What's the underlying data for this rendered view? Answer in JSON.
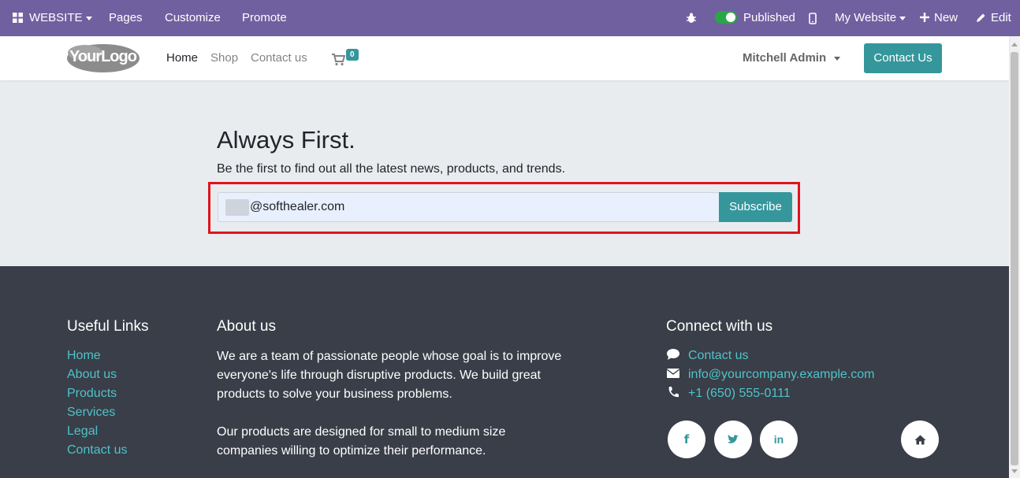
{
  "adminbar": {
    "website_menu": "WEBSITE",
    "pages": "Pages",
    "customize": "Customize",
    "promote": "Promote",
    "published": "Published",
    "site_selector": "My Website",
    "new": "New",
    "edit": "Edit"
  },
  "header": {
    "logo_text": "YourLogo",
    "nav": [
      "Home",
      "Shop",
      "Contact us"
    ],
    "cart_count": "0",
    "user": "Mitchell Admin",
    "contact_button": "Contact Us"
  },
  "newsletter": {
    "title": "Always First.",
    "subtitle": "Be the first to find out all the latest news, products, and trends.",
    "email_value": "@softhealer.com",
    "subscribe_label": "Subscribe"
  },
  "footer": {
    "useful_links_title": "Useful Links",
    "useful_links": [
      "Home",
      "About us",
      "Products",
      "Services",
      "Legal",
      "Contact us"
    ],
    "about_title": "About us",
    "about_p1": [
      "We are a team of passionate people whose goal is to improve",
      "everyone's life through disruptive products. We build great",
      "products to solve your business problems."
    ],
    "about_p2": [
      "Our products are designed for small to medium size",
      "companies willing to optimize their performance."
    ],
    "connect_title": "Connect with us",
    "connect_contact": "Contact us",
    "connect_email": "info@yourcompany.example.com",
    "connect_phone": "+1 (650) 555-0111",
    "social": [
      "facebook-icon",
      "twitter-icon",
      "linkedin-icon",
      "home-icon"
    ]
  },
  "colors": {
    "admin_bar": "#7160a0",
    "primary": "#35979c",
    "link": "#4fc3c9",
    "footer_bg": "#393e48",
    "highlight": "#e0131c"
  }
}
